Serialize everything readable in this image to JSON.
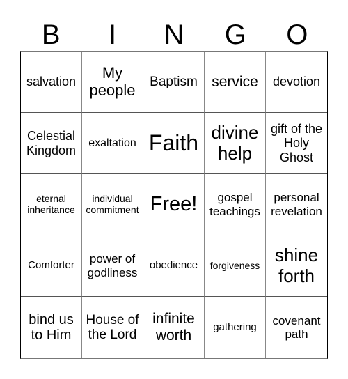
{
  "header": [
    "B",
    "I",
    "N",
    "G",
    "O"
  ],
  "cells": [
    "salvation",
    "My people",
    "Baptism",
    "service",
    "devotion",
    "Celestial Kingdom",
    "exaltation",
    "Faith",
    "divine help",
    "gift of the Holy Ghost",
    "eternal inheritance",
    "individual commitment",
    "Free!",
    "gospel teachings",
    "personal revelation",
    "Comforter",
    "power of godliness",
    "obedience",
    "forgiveness",
    "shine forth",
    "bind us to Him",
    "House of the Lord",
    "infinite worth",
    "gathering",
    "covenant path"
  ]
}
